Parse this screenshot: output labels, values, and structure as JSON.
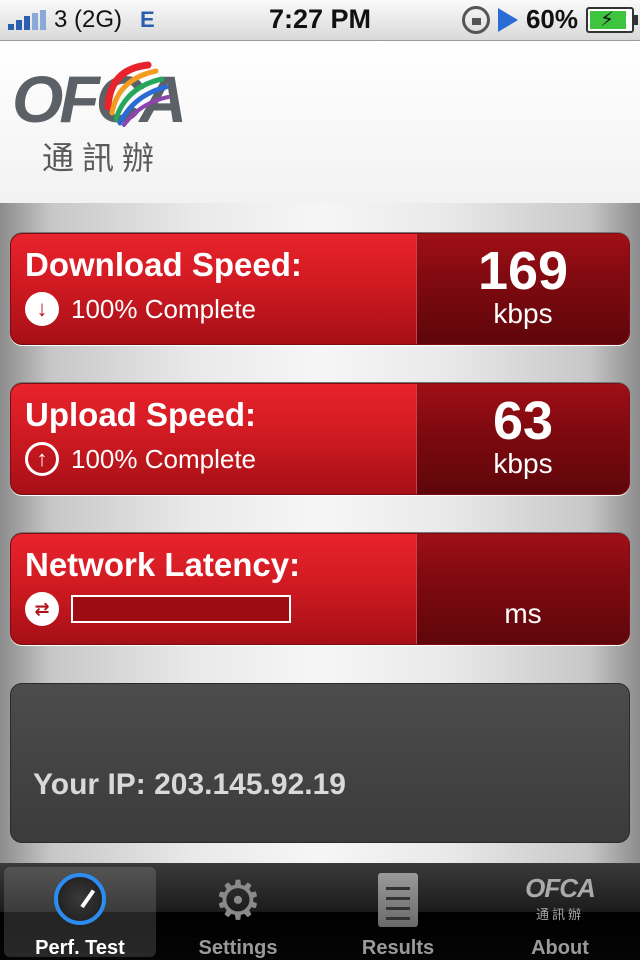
{
  "status_bar": {
    "carrier": "3 (2G)",
    "network": "E",
    "time": "7:27 PM",
    "battery": "60%"
  },
  "header": {
    "logo_text": "OFCA",
    "logo_chinese": "通訊辦"
  },
  "download": {
    "title": "Download Speed:",
    "status": "100% Complete",
    "value": "169",
    "unit": "kbps"
  },
  "upload": {
    "title": "Upload Speed:",
    "status": "100% Complete",
    "value": "63",
    "unit": "kbps"
  },
  "latency": {
    "title": "Network Latency:",
    "unit": "ms"
  },
  "ip": {
    "text": "Your IP: 203.145.92.19"
  },
  "tabs": [
    {
      "label": "Perf. Test",
      "icon": "speedometer-icon",
      "active": true
    },
    {
      "label": "Settings",
      "icon": "gear-icon",
      "active": false
    },
    {
      "label": "Results",
      "icon": "document-icon",
      "active": false
    },
    {
      "label": "About",
      "icon": "ofca-logo-icon",
      "active": false
    }
  ],
  "colors": {
    "card_red": "#d11a22",
    "card_dark": "#800a10",
    "accent_blue": "#2d8cf0"
  }
}
